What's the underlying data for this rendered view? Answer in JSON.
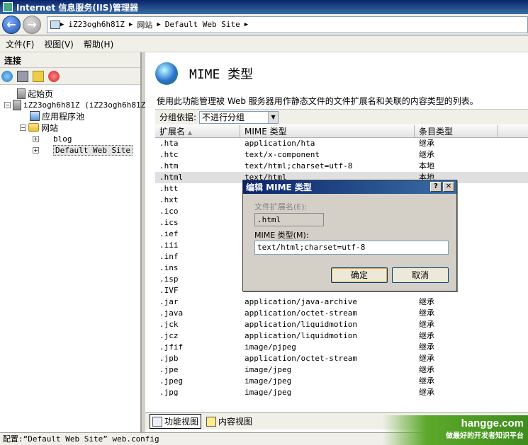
{
  "window": {
    "title": "Internet 信息服务(IIS)管理器"
  },
  "address": {
    "crumbs": [
      "iZ23ogh6h81Z",
      "网站",
      "Default Web Site"
    ]
  },
  "menu": [
    "文件(F)",
    "视图(V)",
    "帮助(H)"
  ],
  "connections": {
    "header": "连接",
    "tree": {
      "start_page": "起始页",
      "server": "iZ23ogh6h81Z (iZ23ogh6h81Z",
      "app_pools": "应用程序池",
      "sites": "网站",
      "blog": "blog",
      "default_site": "Default Web Site"
    }
  },
  "main": {
    "title": "MIME 类型",
    "description": "使用此功能管理被 Web 服务器用作静态文件的文件扩展名和关联的内容类型的列表。",
    "group_label": "分组依据:",
    "group_value": "不进行分组",
    "columns": {
      "ext": "扩展名",
      "mime": "MIME 类型",
      "entry": "条目类型"
    },
    "rows": [
      {
        "ext": ".hta",
        "mime": "application/hta",
        "entry": "继承"
      },
      {
        "ext": ".htc",
        "mime": "text/x-component",
        "entry": "继承"
      },
      {
        "ext": ".htm",
        "mime": "text/html;charset=utf-8",
        "entry": "本地"
      },
      {
        "ext": ".html",
        "mime": "text/html",
        "entry": "本地"
      },
      {
        "ext": ".htt",
        "mime": "",
        "entry": ""
      },
      {
        "ext": ".hxt",
        "mime": "",
        "entry": ""
      },
      {
        "ext": ".ico",
        "mime": "",
        "entry": ""
      },
      {
        "ext": ".ics",
        "mime": "",
        "entry": ""
      },
      {
        "ext": ".ief",
        "mime": "",
        "entry": ""
      },
      {
        "ext": ".iii",
        "mime": "",
        "entry": ""
      },
      {
        "ext": ".inf",
        "mime": "",
        "entry": ""
      },
      {
        "ext": ".ins",
        "mime": "",
        "entry": ""
      },
      {
        "ext": ".isp",
        "mime": "",
        "entry": ""
      },
      {
        "ext": ".IVF",
        "mime": "",
        "entry": ""
      },
      {
        "ext": ".jar",
        "mime": "application/java-archive",
        "entry": "继承"
      },
      {
        "ext": ".java",
        "mime": "application/octet-stream",
        "entry": "继承"
      },
      {
        "ext": ".jck",
        "mime": "application/liquidmotion",
        "entry": "继承"
      },
      {
        "ext": ".jcz",
        "mime": "application/liquidmotion",
        "entry": "继承"
      },
      {
        "ext": ".jfif",
        "mime": "image/pjpeg",
        "entry": "继承"
      },
      {
        "ext": ".jpb",
        "mime": "application/octet-stream",
        "entry": "继承"
      },
      {
        "ext": ".jpe",
        "mime": "image/jpeg",
        "entry": "继承"
      },
      {
        "ext": ".jpeg",
        "mime": "image/jpeg",
        "entry": "继承"
      },
      {
        "ext": ".jpg",
        "mime": "image/jpeg",
        "entry": "继承"
      }
    ],
    "selected_row": 3,
    "tabs": {
      "features": "功能视图",
      "content": "内容视图"
    }
  },
  "status": "配置:“Default Web Site” web.config",
  "watermark": {
    "title": "hangge.com",
    "subtitle": "做最好的开发者知识平台"
  },
  "dialog": {
    "title": "编辑 MIME 类型",
    "ext_label": "文件扩展名(E):",
    "ext_value": ".html",
    "mime_label": "MIME 类型(M):",
    "mime_value": "text/html;charset=utf-8",
    "ok": "确定",
    "cancel": "取消"
  }
}
